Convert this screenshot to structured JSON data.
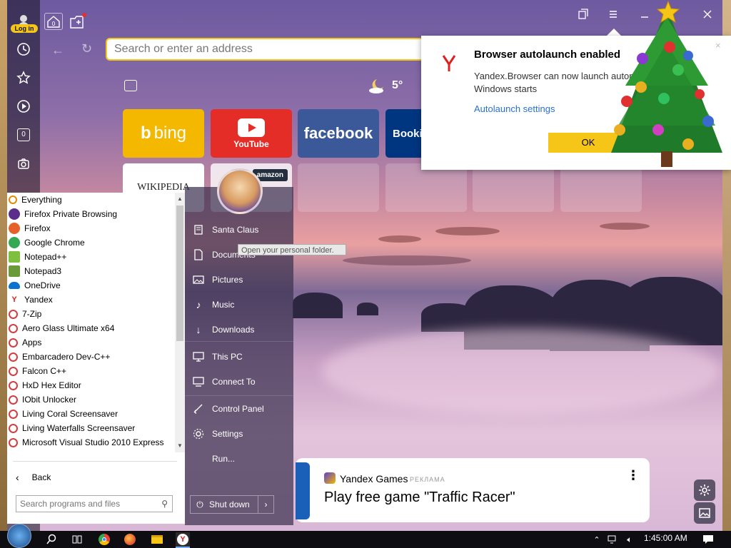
{
  "sidebar": {
    "login_label": "Log in",
    "tab_counter": "0"
  },
  "topbar": {
    "tab_count": "0"
  },
  "address_bar": {
    "placeholder": "Search or enter an address"
  },
  "weather": {
    "temperature": "5°",
    "icon": "moon-cloud-icon"
  },
  "tiles": [
    {
      "label": "bing",
      "color": "#f5b800"
    },
    {
      "label": "YouTube",
      "color": "#e52d27"
    },
    {
      "label": "facebook",
      "color": "#3b5998"
    },
    {
      "label": "Booki",
      "color": "#003580"
    },
    {
      "label": "WIKIPEDIA",
      "color": "#ffffff"
    },
    {
      "label": "amazon",
      "color": "#232f3e"
    }
  ],
  "notification": {
    "title": "Browser autolaunch enabled",
    "body_line1": "Yandex.Browser can now launch autom",
    "body_line2": "Windows starts",
    "link": "Autolaunch settings",
    "ok_label": "OK"
  },
  "start_menu": {
    "programs": [
      {
        "label": "Everything",
        "icon": "magnifier-icon",
        "color": "#e08a00"
      },
      {
        "label": "Firefox Private Browsing",
        "icon": "firefox-private-icon",
        "color": "#5a2d8a"
      },
      {
        "label": "Firefox",
        "icon": "firefox-icon",
        "color": "#e6602a"
      },
      {
        "label": "Google Chrome",
        "icon": "chrome-icon",
        "color": "#34a853"
      },
      {
        "label": "Notepad++",
        "icon": "notepadpp-icon",
        "color": "#7fbf3f"
      },
      {
        "label": "Notepad3",
        "icon": "notepad3-icon",
        "color": "#6a9a3a"
      },
      {
        "label": "OneDrive",
        "icon": "onedrive-icon",
        "color": "#0a72d1"
      },
      {
        "label": "Yandex",
        "icon": "yandex-icon",
        "color": "#e02020"
      },
      {
        "label": "7-Zip",
        "icon": "app-icon",
        "color": "#d04040"
      },
      {
        "label": "Aero Glass Ultimate x64",
        "icon": "app-icon",
        "color": "#d04040"
      },
      {
        "label": "Apps",
        "icon": "app-icon",
        "color": "#d04040"
      },
      {
        "label": "Embarcadero Dev-C++",
        "icon": "app-icon",
        "color": "#d04040"
      },
      {
        "label": "Falcon C++",
        "icon": "app-icon",
        "color": "#d04040"
      },
      {
        "label": "HxD Hex Editor",
        "icon": "app-icon",
        "color": "#d04040"
      },
      {
        "label": "IObit Unlocker",
        "icon": "app-icon",
        "color": "#d04040"
      },
      {
        "label": "Living Coral Screensaver",
        "icon": "app-icon",
        "color": "#d04040"
      },
      {
        "label": "Living Waterfalls Screensaver",
        "icon": "app-icon",
        "color": "#d04040"
      },
      {
        "label": "Microsoft Visual Studio 2010 Express",
        "icon": "app-icon",
        "color": "#d04040"
      }
    ],
    "back_label": "Back",
    "search_placeholder": "Search programs and files",
    "user_name": "Santa Claus",
    "tooltip": "Open your personal folder.",
    "right_items": [
      {
        "label": "Documents",
        "icon": "documents-icon"
      },
      {
        "label": "Pictures",
        "icon": "pictures-icon"
      },
      {
        "label": "Music",
        "icon": "music-icon"
      },
      {
        "label": "Downloads",
        "icon": "downloads-icon"
      },
      {
        "label": "This PC",
        "icon": "computer-icon"
      },
      {
        "label": "Connect To",
        "icon": "connect-icon"
      },
      {
        "label": "Control Panel",
        "icon": "control-panel-icon"
      },
      {
        "label": "Settings",
        "icon": "settings-icon"
      },
      {
        "label": "Run...",
        "icon": "run-icon"
      }
    ],
    "shutdown_label": "Shut down"
  },
  "games_card": {
    "brand": "Yandex Games",
    "ad_label": "РЕКЛАМА",
    "headline": "Play free game \"Traffic Racer\""
  },
  "taskbar": {
    "clock": "1:45:00 AM"
  }
}
